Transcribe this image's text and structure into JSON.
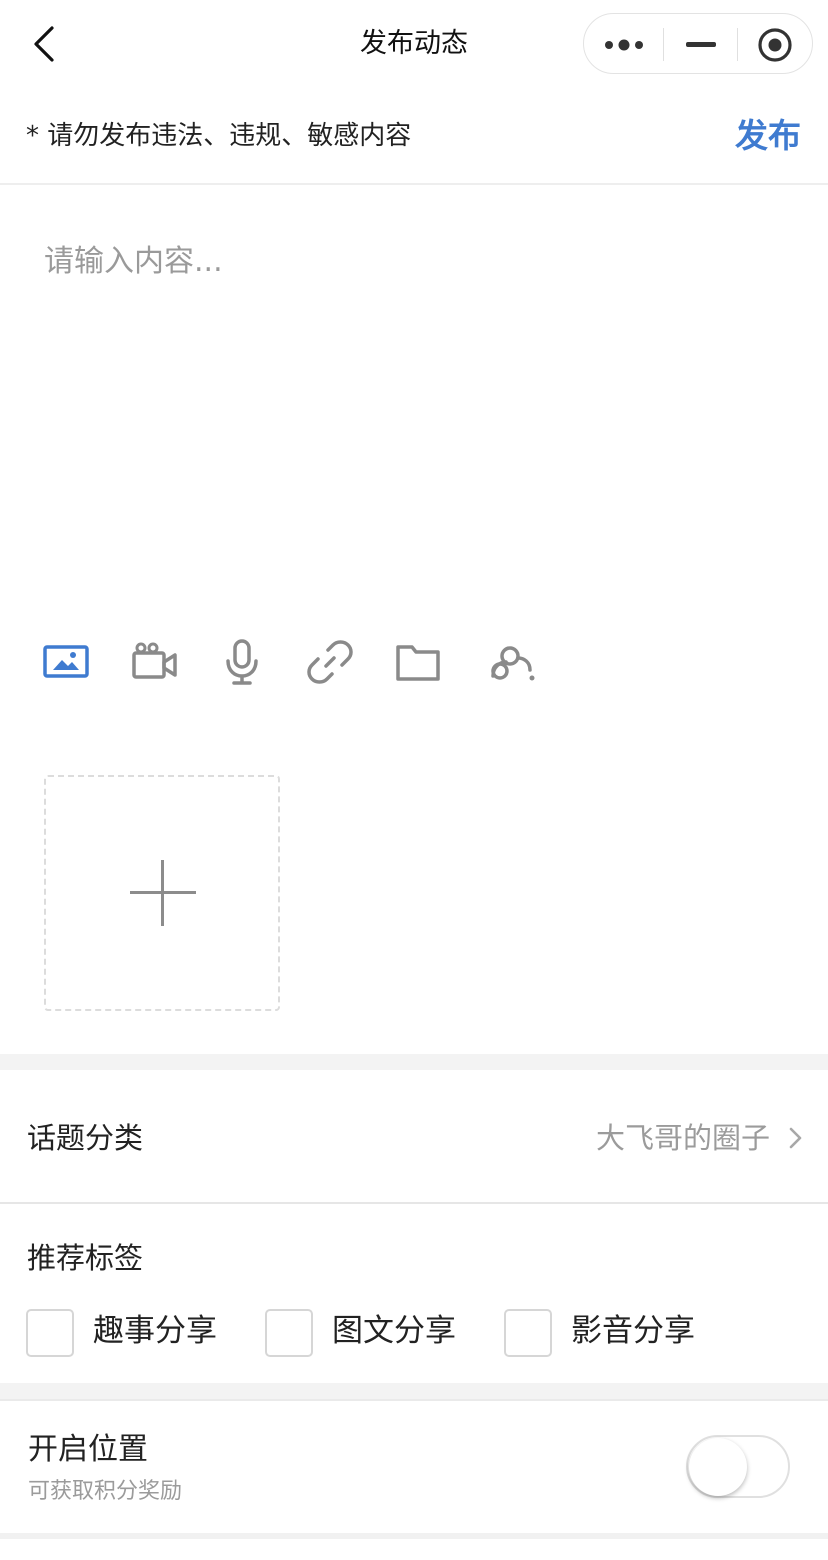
{
  "nav": {
    "title": "发布动态"
  },
  "notice": {
    "text": "* 请勿发布违法、违规、敏感内容",
    "publish_label": "发布"
  },
  "editor": {
    "placeholder": "请输入内容...",
    "value": ""
  },
  "toolbar": {
    "icons": [
      "image-icon",
      "video-icon",
      "microphone-icon",
      "link-icon",
      "folder-icon",
      "person-at-icon"
    ],
    "active": "image-icon",
    "active_color": "#3f7bd0",
    "inactive_color": "#8a8a8a"
  },
  "topic": {
    "label": "话题分类",
    "value": "大飞哥的圈子"
  },
  "tags": {
    "title": "推荐标签",
    "items": [
      {
        "label": "趣事分享",
        "checked": false
      },
      {
        "label": "图文分享",
        "checked": false
      },
      {
        "label": "影音分享",
        "checked": false
      }
    ]
  },
  "location": {
    "title": "开启位置",
    "subtitle": "可获取积分奖励",
    "enabled": false
  },
  "colors": {
    "accent": "#3f7bd0",
    "muted_text": "#9b9b9b",
    "divider": "#eeeeee"
  }
}
